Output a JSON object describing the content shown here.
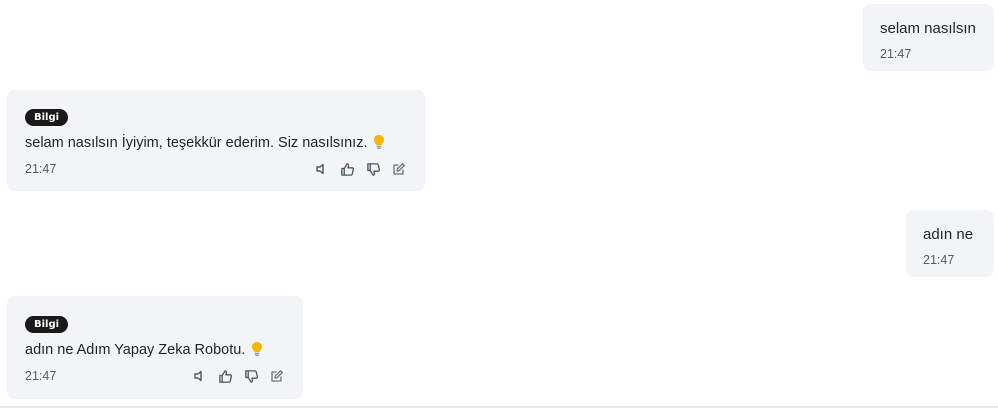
{
  "messages": [
    {
      "role": "user",
      "text": "selam nasılsın",
      "time": "21:47"
    },
    {
      "role": "assistant",
      "badge": "Bilgi",
      "text": "selam nasılsın İyiyim, teşekkür ederim. Siz nasılsınız.",
      "time": "21:47",
      "emoji_icon": "lightbulb-icon",
      "actions": [
        "speaker-icon",
        "thumbs-up-icon",
        "thumbs-down-icon",
        "edit-icon"
      ]
    },
    {
      "role": "user",
      "text": "adın ne",
      "time": "21:47"
    },
    {
      "role": "assistant",
      "badge": "Bilgi",
      "text": "adın ne Adım Yapay Zeka Robotu.",
      "time": "21:47",
      "emoji_icon": "lightbulb-icon",
      "actions": [
        "speaker-icon",
        "thumbs-up-icon",
        "thumbs-down-icon",
        "edit-icon"
      ]
    }
  ],
  "colors": {
    "bubble_bg": "#f3f4f6",
    "badge_bg": "#1a1a1a",
    "icon_gray": "#6b7280",
    "bulb": "#f5b400"
  }
}
